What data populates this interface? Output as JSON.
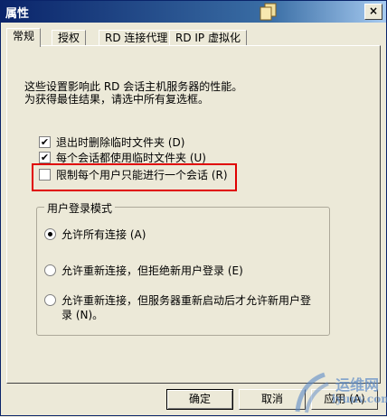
{
  "window": {
    "title": "属性",
    "close_label": "×"
  },
  "tabs": [
    {
      "label": "常规",
      "active": true
    },
    {
      "label": "授权",
      "active": false
    },
    {
      "label": "RD 连接代理",
      "active": false
    },
    {
      "label": "RD IP 虚拟化",
      "active": false
    }
  ],
  "description": {
    "line1": "这些设置影响此 RD 会话主机服务器的性能。",
    "line2": "为获得最佳结果，请选中所有复选框。"
  },
  "checkboxes": [
    {
      "label": "退出时删除临时文件夹 (D)",
      "checked": true
    },
    {
      "label": "每个会话都使用临时文件夹 (U)",
      "checked": true
    },
    {
      "label": "限制每个用户只能进行一个会话 (R)",
      "checked": false
    }
  ],
  "login_mode": {
    "title": "用户登录模式",
    "options": [
      {
        "label": "允许所有连接 (A)",
        "selected": true
      },
      {
        "label": "允许重新连接，但拒绝新用户登录 (E)",
        "selected": false
      },
      {
        "line1": "允许重新连接，但服务器重新启动后才允许新用户登",
        "line2": "录 (N)。",
        "selected": false
      }
    ]
  },
  "buttons": {
    "ok": "确定",
    "cancel": "取消",
    "apply": "应用 (A)"
  },
  "watermark": {
    "text": "运维网",
    "url": "iyunv.com"
  },
  "colors": {
    "title_bar": "#0a246a",
    "highlight_border": "#e00000",
    "dialog_bg": "#ece9d8",
    "watermark": "#5c8ac8"
  }
}
